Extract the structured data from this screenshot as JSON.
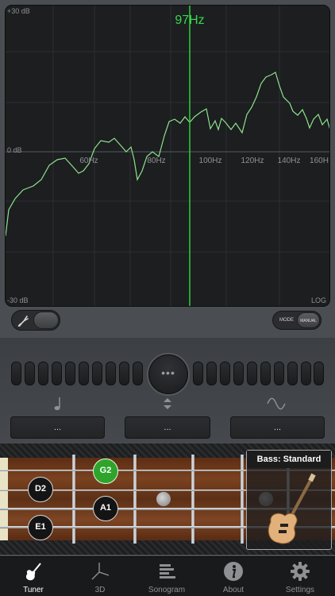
{
  "spectrum": {
    "db_max": "+30 dB",
    "db_mid": "0 dB",
    "db_min": "-30 dB",
    "frequency_readout": "97Hz",
    "scale_mode": "LOG",
    "freq_labels": [
      "60Hz",
      "80Hz",
      "100Hz",
      "120Hz",
      "140Hz",
      "160H"
    ],
    "colors": {
      "trace": "#8ee28b",
      "cursor": "#2ecf3a",
      "readout": "#39d84a"
    }
  },
  "toggles": {
    "input_icon": "tuning-fork-icon",
    "mode_label": "MODE",
    "mode_value": "MANUAL"
  },
  "tuner": {
    "center_dots": "•••",
    "note_icon": "music-note-icon",
    "adjust_icon": "up-down-arrows-icon",
    "wave_icon": "sine-wave-icon",
    "note_value": "...",
    "cents_value": "...",
    "frequency_value": "..."
  },
  "fretboard": {
    "notes": [
      {
        "label": "G2",
        "active": true
      },
      {
        "label": "D2",
        "active": false
      },
      {
        "label": "A1",
        "active": false
      },
      {
        "label": "E1",
        "active": false
      }
    ],
    "tuning_title": "Bass: Standard",
    "active_color": "#2ea52a"
  },
  "tabs": [
    {
      "label": "Tuner",
      "icon": "guitar-icon",
      "active": true
    },
    {
      "label": "3D",
      "icon": "axes-3d-icon",
      "active": false
    },
    {
      "label": "Sonogram",
      "icon": "sonogram-icon",
      "active": false
    },
    {
      "label": "About",
      "icon": "info-icon",
      "active": false
    },
    {
      "label": "Settings",
      "icon": "gear-icon",
      "active": false
    }
  ]
}
